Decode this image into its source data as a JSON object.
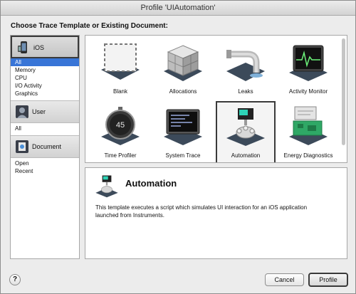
{
  "window": {
    "title": "Profile 'UIAutomation'"
  },
  "heading": "Choose Trace Template or Existing Document:",
  "sidebar": {
    "ios": {
      "label": "iOS",
      "icon": "ios-device-icon"
    },
    "ios_items": [
      "All",
      "Memory",
      "CPU",
      "I/O Activity",
      "Graphics"
    ],
    "user": {
      "label": "User",
      "icon": "user-icon"
    },
    "user_items": [
      "All"
    ],
    "document": {
      "label": "Document",
      "icon": "document-icon"
    },
    "document_items": [
      "Open",
      "Recent"
    ]
  },
  "templates": [
    {
      "label": "Blank",
      "icon": "blank-icon"
    },
    {
      "label": "Allocations",
      "icon": "allocations-icon"
    },
    {
      "label": "Leaks",
      "icon": "leaks-icon"
    },
    {
      "label": "Activity Monitor",
      "icon": "activity-monitor-icon"
    },
    {
      "label": "Time Profiler",
      "icon": "time-profiler-icon"
    },
    {
      "label": "System Trace",
      "icon": "system-trace-icon"
    },
    {
      "label": "Automation",
      "icon": "automation-icon",
      "selected": true
    },
    {
      "label": "Energy Diagnostics",
      "icon": "energy-diagnostics-icon"
    }
  ],
  "timer_text": "45",
  "description": {
    "title": "Automation",
    "text": "This template executes a script which simulates UI interaction for an iOS application launched from Instruments."
  },
  "buttons": {
    "help": "?",
    "cancel": "Cancel",
    "profile": "Profile"
  },
  "colors": {
    "selection": "#3875d7",
    "panel_bg": "#ececec"
  }
}
